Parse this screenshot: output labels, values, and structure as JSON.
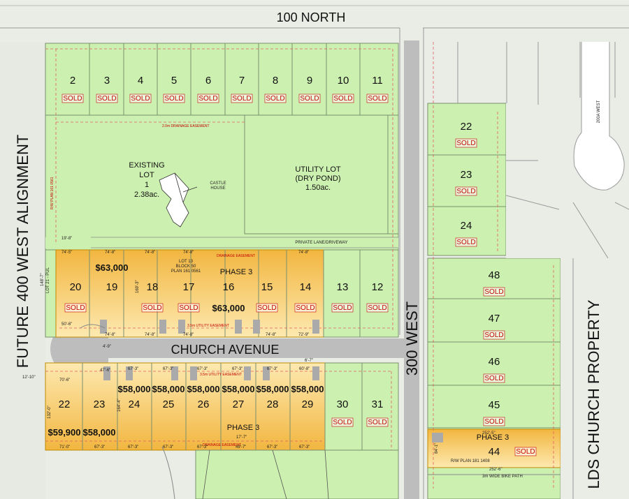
{
  "colors": {
    "lot_green": "#ccf0b0",
    "phase_orange": "#f5bf40",
    "road_grey": "#bfbfbf",
    "block_grey": "#e9ede6",
    "lot_line": "#7a8f6e",
    "sold_red": "#c40000",
    "setback_red": "#e06060"
  },
  "roads": {
    "north": "100 NORTH",
    "west_vertical": "FUTURE 400 WEST ALIGNMENT",
    "avenue": "CHURCH AVENUE",
    "street_300": "300 WEST",
    "east_property": "LDS CHURCH PROPERTY",
    "cul_de_sac": "200A WEST",
    "bike_path": "3m WIDE BIKE PATH",
    "private_lane": "PRIVATE LANE/DRIVEWAY"
  },
  "labels": {
    "existing_lot": [
      "EXISTING",
      "LOT",
      "1",
      "2.38ac."
    ],
    "utility_lot": [
      "UTILITY LOT",
      "(DRY POND)",
      "1.50ac."
    ],
    "castle": [
      "CASTLE",
      "HOUSE"
    ],
    "lot13": [
      "LOT 13",
      "BLOCK 50",
      "PLAN 161 0561"
    ],
    "rw_plan": "R/W PLAN 161 0561",
    "rw_plan_181": "R/W PLAN 181 1408",
    "drainage_easement_top": "2.0m DRAINAGE EASEMENT",
    "drainage_easement": "DRAINAGE EASEMENT",
    "utility_easement": "3.5m UTILITY EASEMENT",
    "lot21_pul": "LOT 21 - PUL",
    "phase": "PHASE 3",
    "sold": "SOLD"
  },
  "lots_top": [
    {
      "num": "2",
      "status": "SOLD"
    },
    {
      "num": "3",
      "status": "SOLD"
    },
    {
      "num": "4",
      "status": "SOLD"
    },
    {
      "num": "5",
      "status": "SOLD"
    },
    {
      "num": "6",
      "status": "SOLD"
    },
    {
      "num": "7",
      "status": "SOLD"
    },
    {
      "num": "8",
      "status": "SOLD"
    },
    {
      "num": "9",
      "status": "SOLD"
    },
    {
      "num": "10",
      "status": "SOLD"
    },
    {
      "num": "11",
      "status": "SOLD"
    }
  ],
  "lots_mid": [
    {
      "num": "20",
      "status": "SOLD",
      "price": ""
    },
    {
      "num": "19",
      "status": "",
      "price": "$63,000"
    },
    {
      "num": "18",
      "status": "SOLD",
      "price": ""
    },
    {
      "num": "17",
      "status": "SOLD",
      "price": ""
    },
    {
      "num": "16",
      "status": "",
      "price": "$63,000"
    },
    {
      "num": "15",
      "status": "SOLD",
      "price": ""
    },
    {
      "num": "14",
      "status": "SOLD",
      "price": ""
    },
    {
      "num": "13",
      "status": "SOLD",
      "price": ""
    },
    {
      "num": "12",
      "status": "SOLD",
      "price": ""
    }
  ],
  "lots_south": [
    {
      "num": "22",
      "price": "$59,900",
      "status": ""
    },
    {
      "num": "23",
      "price": "$58,000",
      "status": ""
    },
    {
      "num": "24",
      "price": "$58,000",
      "status": ""
    },
    {
      "num": "25",
      "price": "$58,000",
      "status": ""
    },
    {
      "num": "26",
      "price": "$58,000",
      "status": ""
    },
    {
      "num": "27",
      "price": "$58,000",
      "status": ""
    },
    {
      "num": "28",
      "price": "$58,000",
      "status": ""
    },
    {
      "num": "29",
      "price": "$58,000",
      "status": ""
    },
    {
      "num": "30",
      "price": "",
      "status": "SOLD"
    },
    {
      "num": "31",
      "price": "",
      "status": "SOLD"
    }
  ],
  "lots_east": [
    {
      "num": "22",
      "status": "SOLD"
    },
    {
      "num": "23",
      "status": "SOLD"
    },
    {
      "num": "24",
      "status": "SOLD"
    },
    {
      "num": "48",
      "status": "SOLD"
    },
    {
      "num": "47",
      "status": "SOLD"
    },
    {
      "num": "46",
      "status": "SOLD"
    },
    {
      "num": "45",
      "status": "SOLD"
    },
    {
      "num": "44",
      "status": "SOLD"
    }
  ],
  "dims": {
    "top_row": [
      "74'-5\"",
      "74'-8\"",
      "74'-8\"",
      "74'-8\"",
      "74'-8\""
    ],
    "bottom_row": [
      "74'-8\"",
      "74'-8\"",
      "74'-8\"",
      "74'-8\"",
      "72'-9\""
    ],
    "south_top": [
      "70'-6\"",
      "47'-6\"",
      "67'-3\"",
      "67'-3\"",
      "67'-3\"",
      "67'-3\"",
      "67'-3\"",
      "60'-8\""
    ],
    "south_bottom": [
      "71'-0\"",
      "67'-3\"",
      "67'-3\"",
      "67'-3\"",
      "67'-3\"",
      "49'-7\"",
      "67'-3\"",
      "67'-3\""
    ],
    "misc": [
      "19'-8\"",
      "50'-6\"",
      "148'-7\"",
      "4'-9\"",
      "12'-10\"",
      "6'-7\"",
      "17'-7\"",
      "252'-5\"",
      "252'-6\"",
      "84'-1\"",
      "169'-3\"",
      "164'-4\"",
      "132'-0\""
    ]
  }
}
